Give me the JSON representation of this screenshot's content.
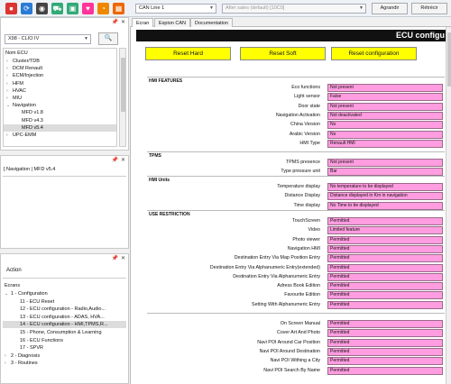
{
  "toolbar": {
    "icons": [
      {
        "name": "stop-icon",
        "glyph": "⏹",
        "color": "#d33"
      },
      {
        "name": "refresh-icon",
        "glyph": "⟳",
        "color": "#2a7bd5"
      },
      {
        "name": "disk-icon",
        "glyph": "◉",
        "color": "#444"
      },
      {
        "name": "car-icon",
        "glyph": "⛟",
        "color": "#3a7"
      },
      {
        "name": "window-icon",
        "glyph": "▣",
        "color": "#3a7"
      },
      {
        "name": "heartbeat-icon",
        "glyph": "♥",
        "color": "#f39"
      },
      {
        "name": "gauge-icon",
        "glyph": "◔",
        "color": "#e80"
      },
      {
        "name": "blocks-icon",
        "glyph": "▦",
        "color": "#e60"
      }
    ],
    "can_line": "CAN Line 1",
    "after_sales": "After sales (default) [10C0]",
    "apply_label": "Agrandir",
    "back_label": "Rétrécir"
  },
  "vehicle_panel": {
    "vehicle_select": "X98 - CLIO IV",
    "header": "Nom ECU",
    "tree": [
      {
        "label": "Cluster/TDB",
        "level": 0,
        "caret": "›"
      },
      {
        "label": "DCM Renault",
        "level": 0,
        "caret": "›"
      },
      {
        "label": "ECM/Injection",
        "level": 0,
        "caret": "›"
      },
      {
        "label": "HFM",
        "level": 0,
        "caret": "›"
      },
      {
        "label": "HVAC",
        "level": 0,
        "caret": "›"
      },
      {
        "label": "MIU",
        "level": 0,
        "caret": "›"
      },
      {
        "label": "Navigation",
        "level": 0,
        "caret": "⌄"
      },
      {
        "label": "MFD v1.8",
        "level": 1,
        "caret": ""
      },
      {
        "label": "MFD v4.3",
        "level": 1,
        "caret": ""
      },
      {
        "label": "MFD v5.4",
        "level": 1,
        "caret": "",
        "selected": true
      },
      {
        "label": "UPC-EMM",
        "level": 0,
        "caret": "›"
      }
    ]
  },
  "info_panel": {
    "title": "[ Navigation | MFD v5.4"
  },
  "action_panel": {
    "action_label": "Action",
    "screens_label": "Ecrans",
    "tree": [
      {
        "label": "1 - Configuration",
        "level": 0,
        "caret": "⌄"
      },
      {
        "label": "11 - ECU Reset",
        "level": 1,
        "caret": ""
      },
      {
        "label": "12 - ECU configuration - Radio,Audio...",
        "level": 1,
        "caret": ""
      },
      {
        "label": "13 - ECU configuration - ADAS, HVA...",
        "level": 1,
        "caret": ""
      },
      {
        "label": "14 - ECU configuration - HMI,TPMS,R...",
        "level": 1,
        "caret": "",
        "selected": true
      },
      {
        "label": "15 - Phone, Consumption & Learning",
        "level": 1,
        "caret": ""
      },
      {
        "label": "16 - ECU Functions",
        "level": 1,
        "caret": ""
      },
      {
        "label": "17 - SPVR",
        "level": 1,
        "caret": ""
      },
      {
        "label": "2 - Diagnosis",
        "level": 0,
        "caret": "›"
      },
      {
        "label": "3 - Routines",
        "level": 0,
        "caret": "›"
      }
    ]
  },
  "tabs": [
    "Ecran",
    "Espion CAN",
    "Documentation"
  ],
  "main": {
    "banner": "ECU configu",
    "buttons": [
      "Reset Hard",
      "Reset Soft",
      "Reset configuration"
    ],
    "sections": [
      {
        "title": "HMI FEATURES",
        "rows": [
          {
            "label": "Eco functions",
            "value": "Not present"
          },
          {
            "label": "Light sensor",
            "value": "False"
          },
          {
            "label": "Door state",
            "value": "Not present"
          },
          {
            "label": "Navigation Activation",
            "value": "Not deactivated"
          },
          {
            "label": "China Version",
            "value": "No"
          },
          {
            "label": "Arabic Version",
            "value": "No"
          },
          {
            "label": "HMI Type",
            "value": "Renault HMI"
          }
        ]
      },
      {
        "title": "TPMS",
        "rows": [
          {
            "label": "TPMS presence",
            "value": "Not present"
          },
          {
            "label": "Type pressure unit",
            "value": "Bar"
          }
        ]
      },
      {
        "title": "HMI Units",
        "rows": [
          {
            "label": "Temperature display",
            "value": "No temperature to be displayed"
          },
          {
            "label": "Distance Display",
            "value": "Distance displayed in Km in navigation"
          },
          {
            "label": "Time display",
            "value": "No Time to be displayed"
          }
        ]
      },
      {
        "title": "USE RESTRICTION",
        "rows": [
          {
            "label": "TouchScreen",
            "value": "Permitted"
          },
          {
            "label": "Video",
            "value": "Limited feature"
          },
          {
            "label": "Photo viewer",
            "value": "Permitted"
          },
          {
            "label": "Navigation HMI",
            "value": "Permitted"
          },
          {
            "label": "Destination Entry Via Map Position Entry",
            "value": "Permitted"
          },
          {
            "label": "Destination Entry Via Alphanumeric Entry(extended)",
            "value": "Permitted"
          },
          {
            "label": "Destination Entry Via Alphanumeric Entry",
            "value": "Permitted"
          },
          {
            "label": "Adress Book Edition",
            "value": "Permitted"
          },
          {
            "label": "Favourite Edition",
            "value": "Permitted"
          },
          {
            "label": "Setting With Alphanumeric Entry",
            "value": "Permitted"
          }
        ]
      },
      {
        "title": "",
        "rows": [
          {
            "label": "On Screen Manual",
            "value": "Permitted"
          },
          {
            "label": "Cover Art And Photo",
            "value": "Permitted"
          },
          {
            "label": "Navi POI Around Car Position",
            "value": "Permitted"
          },
          {
            "label": "Navi POI Around Destination",
            "value": "Permitted"
          },
          {
            "label": "Navi POI Withing a City",
            "value": "Permitted"
          },
          {
            "label": "Navi POI Search By Name",
            "value": "Permitted"
          }
        ]
      }
    ]
  }
}
